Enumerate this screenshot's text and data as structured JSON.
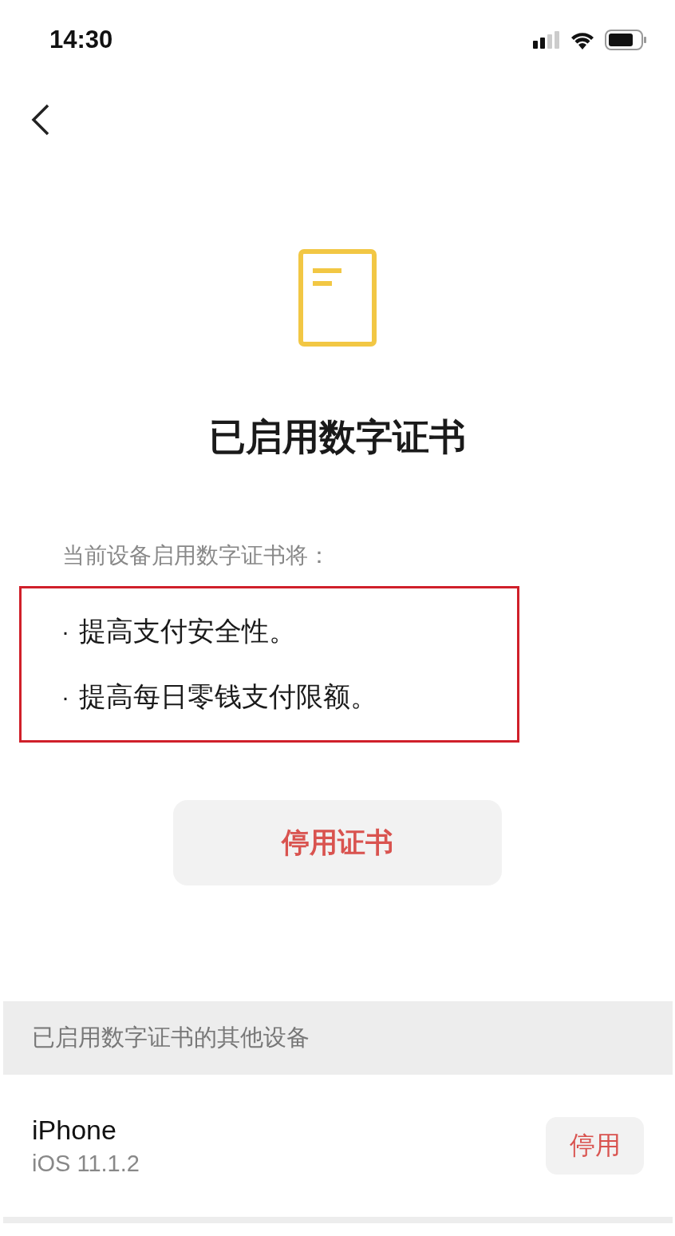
{
  "status_bar": {
    "time": "14:30"
  },
  "title": "已启用数字证书",
  "intro": "当前设备启用数字证书将：",
  "benefits": {
    "highlighted": true,
    "items": [
      {
        "bullet": "·",
        "text": "提高支付安全性。"
      },
      {
        "bullet": "·",
        "text": "提高每日零钱支付限额。"
      }
    ]
  },
  "disable_button": "停用证书",
  "other_devices": {
    "heading": "已启用数字证书的其他设备",
    "devices": [
      {
        "name": "iPhone",
        "os": "iOS 11.1.2",
        "action": "停用"
      }
    ]
  }
}
